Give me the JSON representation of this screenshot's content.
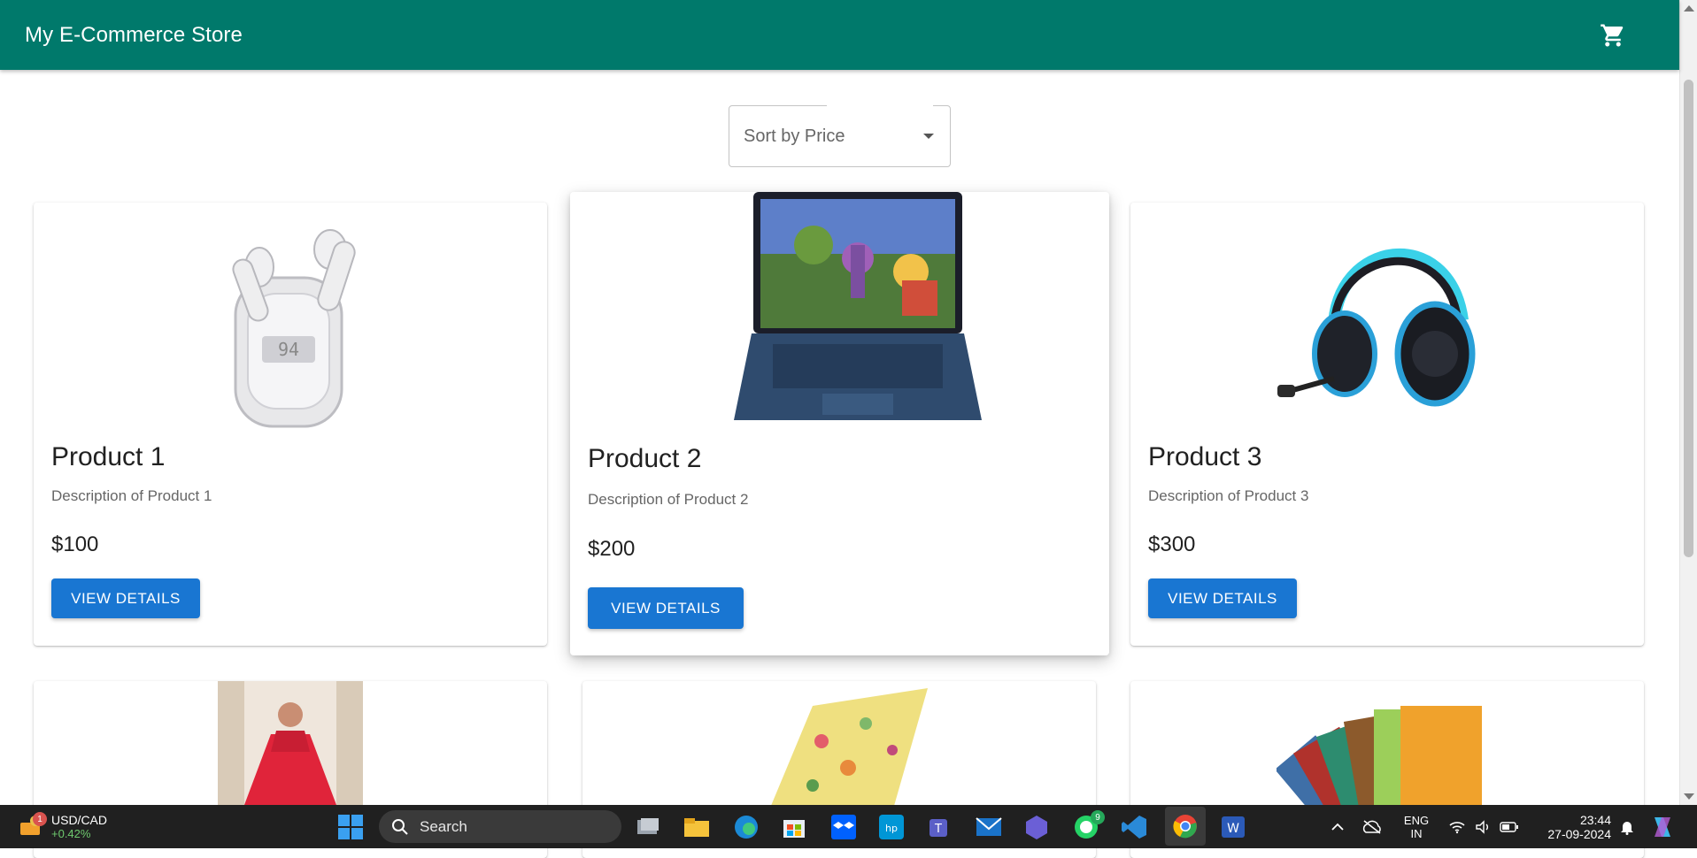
{
  "app": {
    "title": "My E-Commerce Store",
    "cart_icon": "shopping-cart-icon"
  },
  "sort": {
    "label": "Sort by Price",
    "icon": "caret-down-icon"
  },
  "products": [
    {
      "name": "Product 1",
      "description": "Description of Product 1",
      "price": "$100",
      "button": "VIEW DETAILS",
      "image": "earbuds-image"
    },
    {
      "name": "Product 2",
      "description": "Description of Product 2",
      "price": "$200",
      "button": "VIEW DETAILS",
      "image": "laptop-image"
    },
    {
      "name": "Product 3",
      "description": "Description of Product 3",
      "price": "$300",
      "button": "VIEW DETAILS",
      "image": "headphones-image"
    },
    {
      "image": "red-dress-image"
    },
    {
      "image": "floral-notebook-image"
    },
    {
      "image": "notebooks-stack-image"
    }
  ],
  "taskbar": {
    "widget_title": "USD/CAD",
    "widget_change": "+0.42%",
    "widget_badge": "1",
    "search_label": "Search",
    "whatsapp_badge": "9",
    "language": "ENG",
    "region": "IN",
    "time": "23:44",
    "date": "27-09-2024"
  },
  "colors": {
    "appbar": "#00796b",
    "primary_button": "#1976d2",
    "taskbar": "#202020"
  }
}
